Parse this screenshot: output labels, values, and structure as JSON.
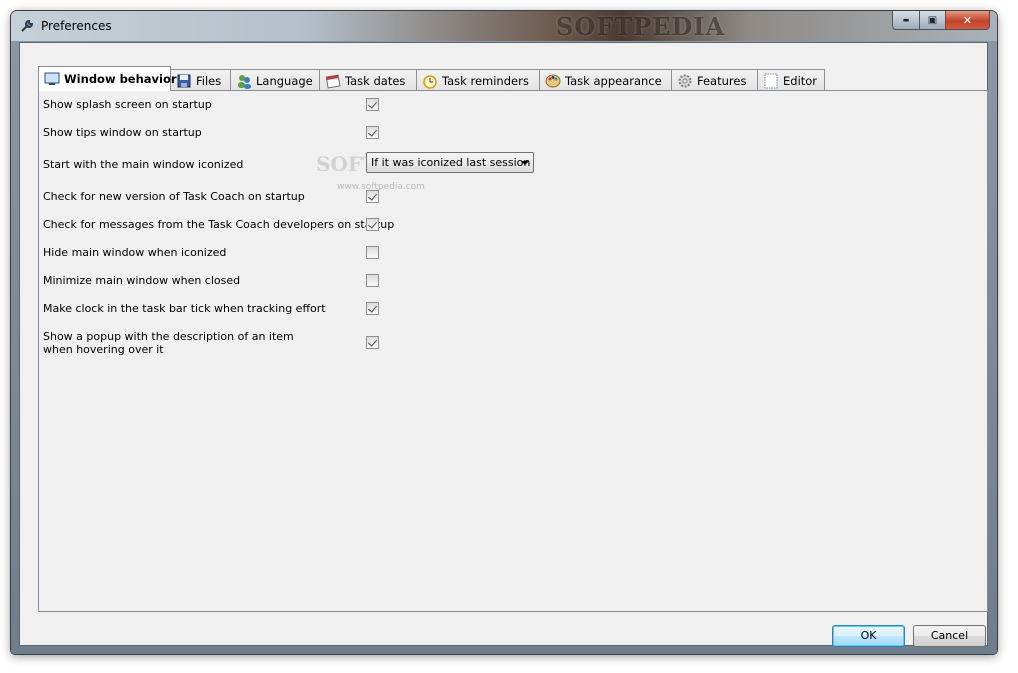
{
  "window": {
    "title": "Preferences",
    "watermark": "SOFTPEDIA"
  },
  "caption_buttons": {
    "minimize": "▬",
    "maximize": "▣",
    "close": "✕"
  },
  "tabs": [
    {
      "label": "Window behavior",
      "icon": "monitor-icon",
      "active": true
    },
    {
      "label": "Files",
      "icon": "floppy-disk-icon",
      "active": false
    },
    {
      "label": "Language",
      "icon": "people-icon",
      "active": false
    },
    {
      "label": "Task dates",
      "icon": "calendar-icon",
      "active": false
    },
    {
      "label": "Task reminders",
      "icon": "alarm-clock-icon",
      "active": false
    },
    {
      "label": "Task appearance",
      "icon": "palette-icon",
      "active": false
    },
    {
      "label": "Features",
      "icon": "gear-icon",
      "active": false
    },
    {
      "label": "Editor",
      "icon": "document-icon",
      "active": false
    }
  ],
  "settings": [
    {
      "label": "Show splash screen on startup",
      "checked": true
    },
    {
      "label": "Show tips window on startup",
      "checked": true
    },
    {
      "label": "Start with the main window iconized",
      "select_value": "If it was iconized last session"
    },
    {
      "label": "Check for new version of Task Coach on startup",
      "checked": true
    },
    {
      "label": "Check for messages from the Task Coach developers on startup",
      "checked": true
    },
    {
      "label": "Hide main window when iconized",
      "checked": false
    },
    {
      "label": "Minimize main window when closed",
      "checked": false
    },
    {
      "label": "Make clock in the task bar tick when tracking effort",
      "checked": true
    },
    {
      "label_line1": "Show a popup with the description of an item",
      "label_line2": "when hovering over it",
      "checked": true
    }
  ],
  "panel_watermark": {
    "big": "SOFT",
    "url": "www.softpedia.com"
  },
  "buttons": {
    "ok": "OK",
    "cancel": "Cancel"
  },
  "colors": {
    "ok_border": "#3c7fb1",
    "close_button": "#c0452c",
    "panel_bg": "#f0f0f0"
  }
}
